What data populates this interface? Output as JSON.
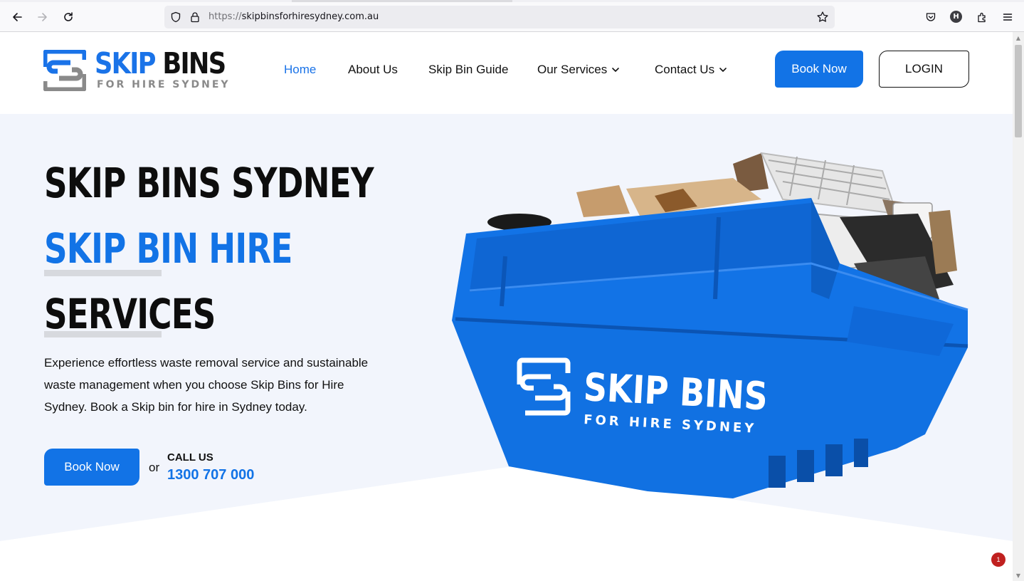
{
  "browser": {
    "url_scheme": "https://",
    "url_host": "skipbinsforhiresydney.com.au",
    "profile_initial": "H",
    "icons": [
      "back-icon",
      "forward-icon",
      "reload-icon",
      "shield-icon",
      "lock-icon",
      "star-icon",
      "pocket-icon",
      "extensions-icon",
      "menu-icon"
    ]
  },
  "logo": {
    "word1": "SKIP",
    "word2": " BINS",
    "subtitle": "FOR HIRE SYDNEY"
  },
  "nav": {
    "home": "Home",
    "about": "About Us",
    "guide": "Skip Bin Guide",
    "services": "Our Services",
    "contact": "Contact Us",
    "book_now": "Book Now",
    "login": "LOGIN"
  },
  "hero": {
    "line1": "SKIP BINS SYDNEY",
    "line2": "SKIP BIN HIRE",
    "line3": "SERVICES",
    "description": "Experience effortless waste removal service and sustainable waste management when you choose Skip Bins for Hire Sydney. Book a Skip bin for hire in Sydney today.",
    "book_button": "Book Now",
    "or": "or",
    "call_label": "CALL US",
    "phone": "1300 707 000"
  },
  "bin_image": {
    "brand_line1": "SKIP BINS",
    "brand_line2": "FOR HIRE SYDNEY"
  },
  "notification_count": "1",
  "colors": {
    "brand_blue": "#1273e6",
    "hero_bg": "#f2f5fc",
    "text_dark": "#111111"
  }
}
